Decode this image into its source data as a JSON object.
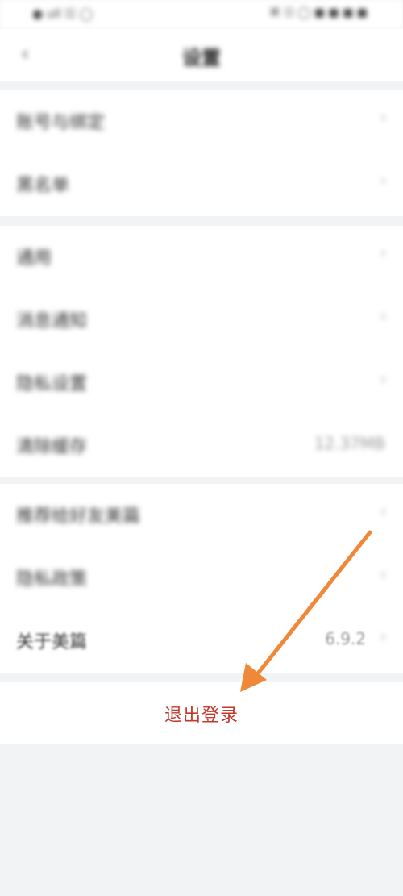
{
  "status_bar": {
    "left_text": "● ull ☷ ◯",
    "right_text": "⌘ ☷ ◯ ■ ■ ■ ■"
  },
  "nav": {
    "back_icon": "‹",
    "title": "设置"
  },
  "group1": [
    {
      "label": "账号与绑定",
      "chevron": "›"
    },
    {
      "label": "黑名单",
      "chevron": "›"
    }
  ],
  "group2": [
    {
      "label": "通用",
      "chevron": "›"
    },
    {
      "label": "消息通知",
      "chevron": "›"
    },
    {
      "label": "隐私设置",
      "chevron": "›"
    },
    {
      "label": "清除缓存",
      "value": "12.37MB"
    }
  ],
  "group3": [
    {
      "label": "推荐给好友美篇",
      "chevron": "›"
    },
    {
      "label": "隐私政策",
      "chevron": "›"
    },
    {
      "label": "关于美篇",
      "value": "6.9.2",
      "chevron": "›"
    }
  ],
  "logout": {
    "label": "退出登录"
  },
  "colors": {
    "logout_text": "#c0392b",
    "annotation_arrow": "#f0883a",
    "background": "#f2f3f5"
  }
}
